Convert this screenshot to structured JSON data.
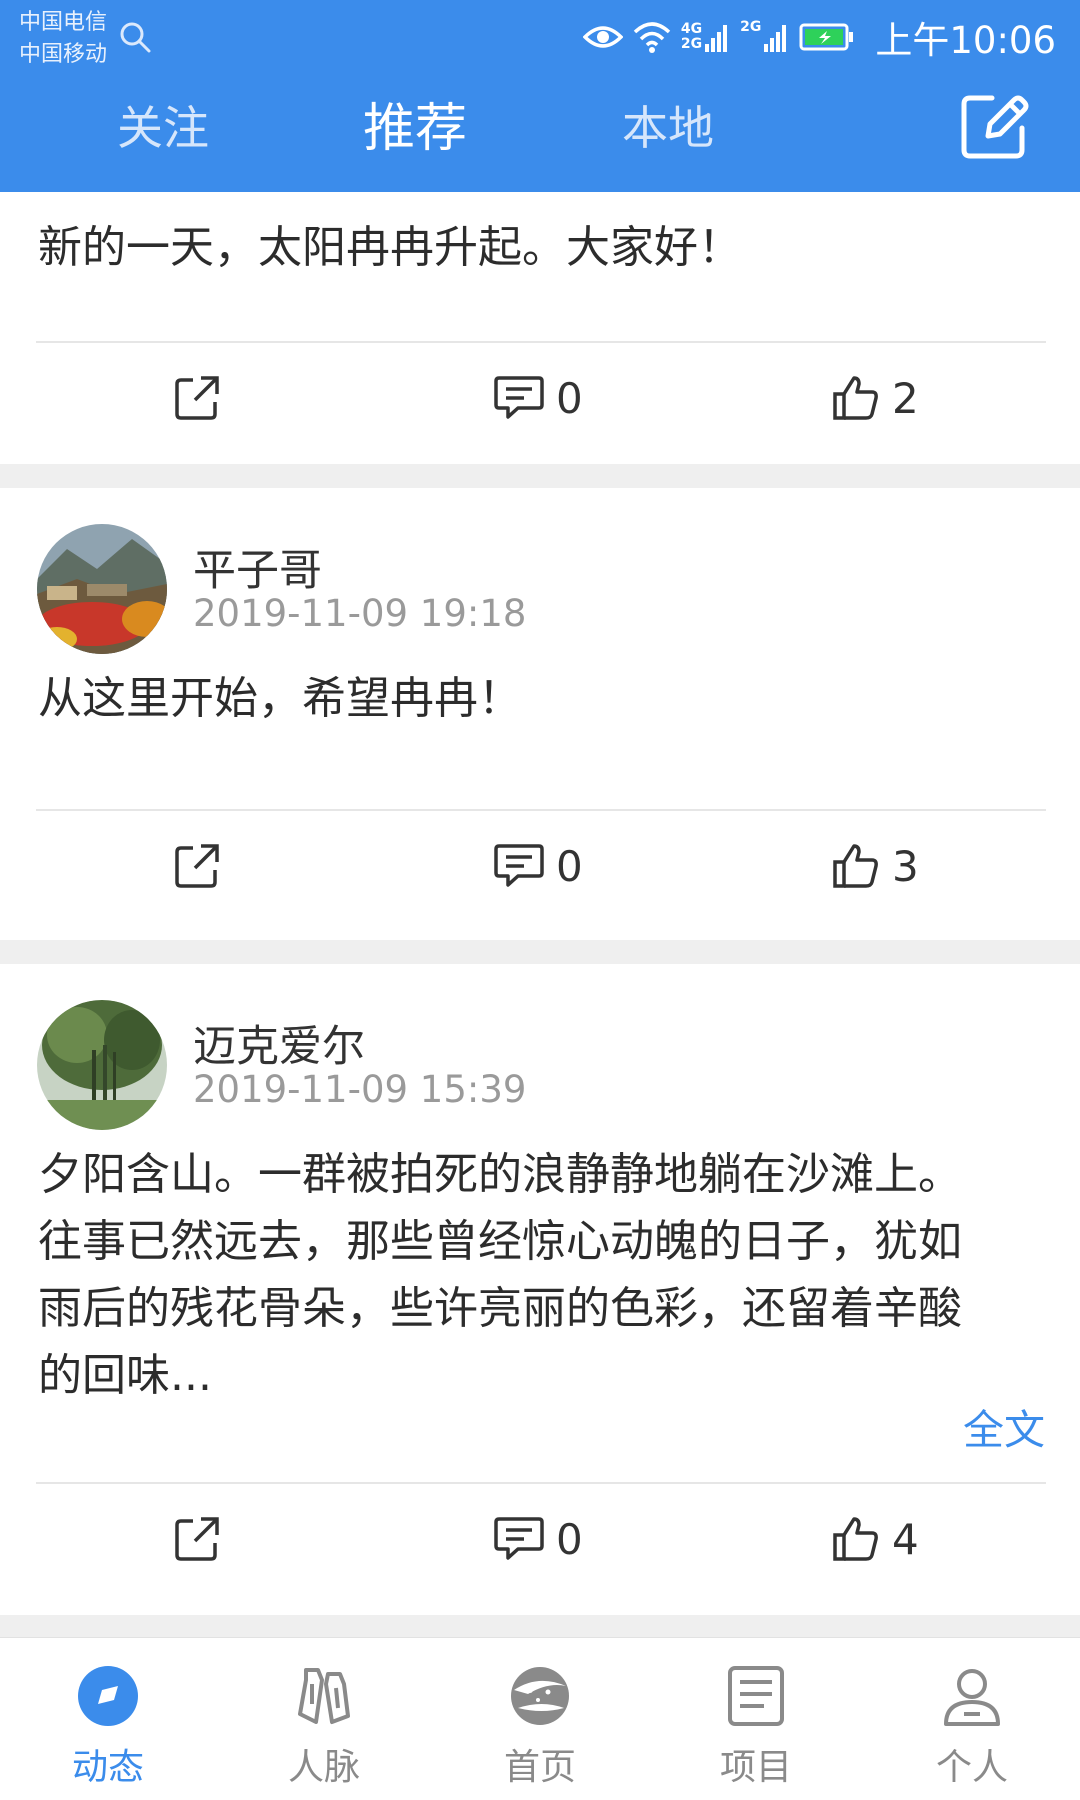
{
  "status_bar": {
    "carrier1": "中国电信",
    "carrier2": "中国移动",
    "net1_top": "4G",
    "net1_bottom": "2G",
    "net2": "2G",
    "time": "上午10:06"
  },
  "header": {
    "tabs": [
      {
        "label": "关注",
        "active": false
      },
      {
        "label": "推荐",
        "active": true
      },
      {
        "label": "本地",
        "active": false
      }
    ]
  },
  "posts": [
    {
      "text": "新的一天，太阳冉冉升起。大家好！",
      "comments": "0",
      "likes": "2"
    },
    {
      "author": "平子哥",
      "time": "2019-11-09 19:18",
      "text": "从这里开始，希望冉冉！",
      "comments": "0",
      "likes": "3"
    },
    {
      "author": "迈克爱尔",
      "time": "2019-11-09 15:39",
      "text_lines": [
        "夕阳含山。一群被拍死的浪静静地躺在沙滩上。",
        "往事已然远去，那些曾经惊心动魄的日子，犹如",
        "雨后的残花骨朵，些许亮丽的色彩，还留着辛酸",
        "的回味..."
      ],
      "more_label": "全文",
      "comments": "0",
      "likes": "4"
    }
  ],
  "bottom_nav": [
    {
      "label": "动态",
      "icon": "feed-icon",
      "active": true
    },
    {
      "label": "人脉",
      "icon": "contacts-icon",
      "active": false
    },
    {
      "label": "首页",
      "icon": "home-globe-icon",
      "active": false
    },
    {
      "label": "项目",
      "icon": "project-icon",
      "active": false
    },
    {
      "label": "个人",
      "icon": "person-icon",
      "active": false
    }
  ],
  "colors": {
    "primary": "#3b8ceb",
    "separator": "#efefef",
    "muted_text": "#9a9a9a"
  }
}
